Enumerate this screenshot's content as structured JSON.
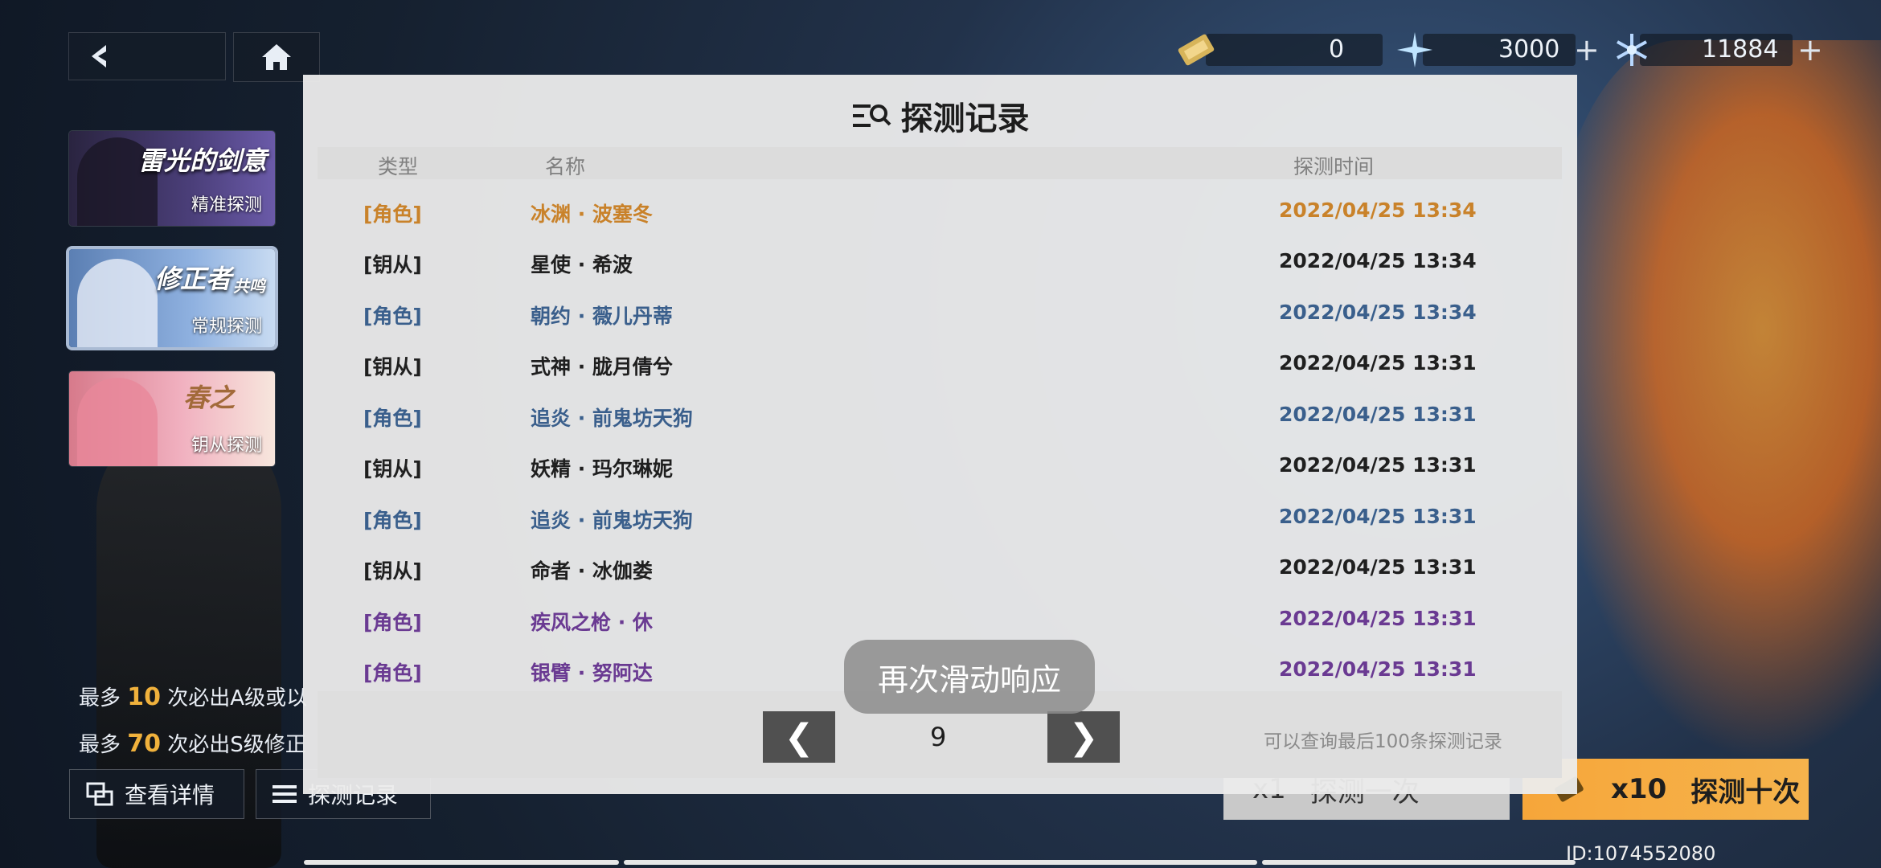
{
  "top": {
    "currencies": [
      {
        "icon": "ticket-icon",
        "value": "0",
        "has_plus": false
      },
      {
        "icon": "star-crystal-icon",
        "value": "3000",
        "has_plus": true
      },
      {
        "icon": "snowflake-crystal-icon",
        "value": "11884",
        "has_plus": true
      }
    ]
  },
  "banners": [
    {
      "title": "雷光的剑意",
      "subtitle": "精准探测"
    },
    {
      "title": "修正者",
      "title_suffix": "共鸣",
      "subtitle": "常规探测"
    },
    {
      "title": "春之",
      "subtitle": "钥从探测"
    }
  ],
  "info": {
    "line1_prefix": "最多",
    "line1_num": "10",
    "line1_suffix": "次必出A级或以",
    "line2_prefix": "最多",
    "line2_num": "70",
    "line2_suffix": "次必出S级修正"
  },
  "buttons": {
    "details": "查看详情",
    "records": "探测记录",
    "pull1_mult": "x1",
    "pull1_label": "探测一次",
    "pull10_mult": "x10",
    "pull10_label": "探测十次"
  },
  "uid": "ID:1074552080",
  "modal": {
    "title": "探测记录",
    "headers": {
      "type": "类型",
      "name": "名称",
      "time": "探测时间"
    },
    "rows": [
      {
        "type": "[角色]",
        "name": "冰渊 · 波塞冬",
        "time": "2022/04/25 13:34",
        "color": "#c9822a"
      },
      {
        "type": "[钥从]",
        "name": "星使 · 希波",
        "time": "2022/04/25 13:34",
        "color": "#1f1f1f"
      },
      {
        "type": "[角色]",
        "name": "朝约 · 薇儿丹蒂",
        "time": "2022/04/25 13:34",
        "color": "#3a5f8c"
      },
      {
        "type": "[钥从]",
        "name": "式神 · 胧月倩兮",
        "time": "2022/04/25 13:31",
        "color": "#1f1f1f"
      },
      {
        "type": "[角色]",
        "name": "追炎 · 前鬼坊天狗",
        "time": "2022/04/25 13:31",
        "color": "#3a5f8c"
      },
      {
        "type": "[钥从]",
        "name": "妖精 · 玛尔琳妮",
        "time": "2022/04/25 13:31",
        "color": "#1f1f1f"
      },
      {
        "type": "[角色]",
        "name": "追炎 · 前鬼坊天狗",
        "time": "2022/04/25 13:31",
        "color": "#3a5f8c"
      },
      {
        "type": "[钥从]",
        "name": "命者 · 冰伽娄",
        "time": "2022/04/25 13:31",
        "color": "#1f1f1f"
      },
      {
        "type": "[角色]",
        "name": "疾风之枪 · 休",
        "time": "2022/04/25 13:31",
        "color": "#6a3a92"
      },
      {
        "type": "[角色]",
        "name": "银臂 · 努阿达",
        "time": "2022/04/25 13:31",
        "color": "#6a3a92"
      }
    ],
    "page": "9",
    "prev": "❮",
    "next": "❯",
    "note": "可以查询最后100条探测记录"
  },
  "toast": "再次滑动响应"
}
